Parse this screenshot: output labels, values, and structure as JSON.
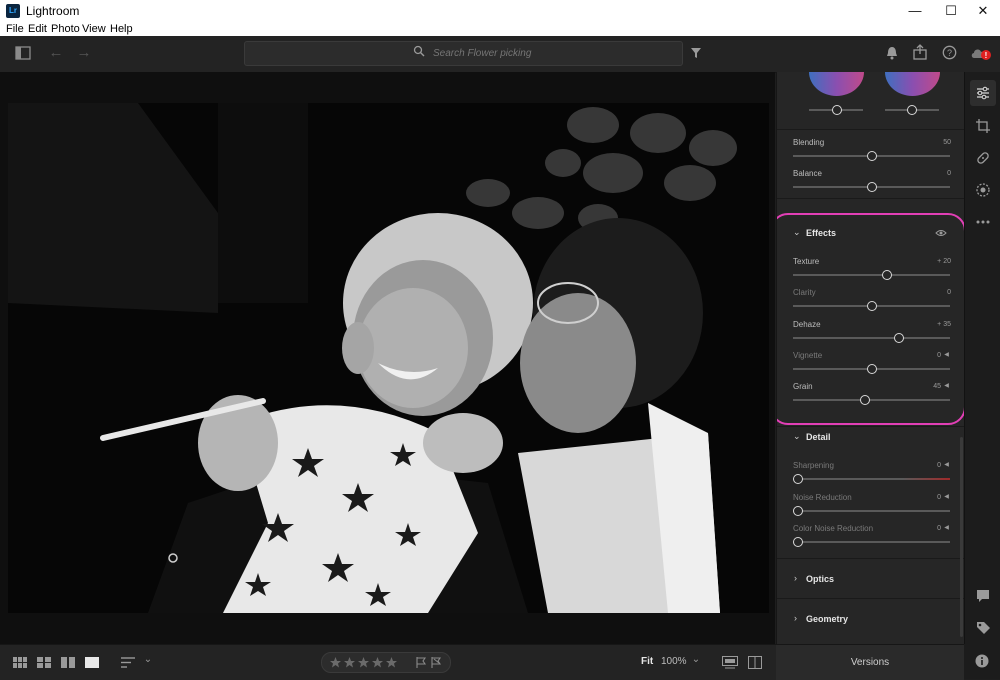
{
  "window": {
    "title": "Lightroom",
    "app_icon_text": "Lr",
    "minimize": "—",
    "maximize": "☐",
    "close": "✕"
  },
  "menu": [
    "File",
    "Edit",
    "Photo",
    "View",
    "Help"
  ],
  "search": {
    "placeholder": "Search Flower picking"
  },
  "panel": {
    "color_grading": {
      "blending_label": "Blending",
      "blending_value": "50",
      "blending_fraction": 0.5,
      "balance_label": "Balance",
      "balance_value": "0",
      "balance_fraction": 0.5,
      "wheel_slider_left_fraction": 0.5,
      "wheel_slider_right_fraction": 0.5
    },
    "effects": {
      "title": "Effects",
      "texture_label": "Texture",
      "texture_value": "+ 20",
      "texture_fraction": 0.6,
      "clarity_label": "Clarity",
      "clarity_value": "0",
      "clarity_fraction": 0.5,
      "dehaze_label": "Dehaze",
      "dehaze_value": "+ 35",
      "dehaze_fraction": 0.675,
      "vignette_label": "Vignette",
      "vignette_value": "0",
      "vignette_fraction": 0.5,
      "grain_label": "Grain",
      "grain_value": "45",
      "grain_fraction": 0.45
    },
    "detail": {
      "title": "Detail",
      "sharpening_label": "Sharpening",
      "sharpening_value": "0",
      "noise_reduction_label": "Noise Reduction",
      "noise_reduction_value": "0",
      "color_noise_reduction_label": "Color Noise Reduction",
      "color_noise_reduction_value": "0"
    },
    "optics_title": "Optics",
    "geometry_title": "Geometry"
  },
  "bottom": {
    "zoom_fit": "Fit",
    "zoom_level": "100%",
    "versions": "Versions"
  },
  "colors": {
    "highlight_ring": "#e23fb6",
    "notification_badge": "#e02020"
  }
}
